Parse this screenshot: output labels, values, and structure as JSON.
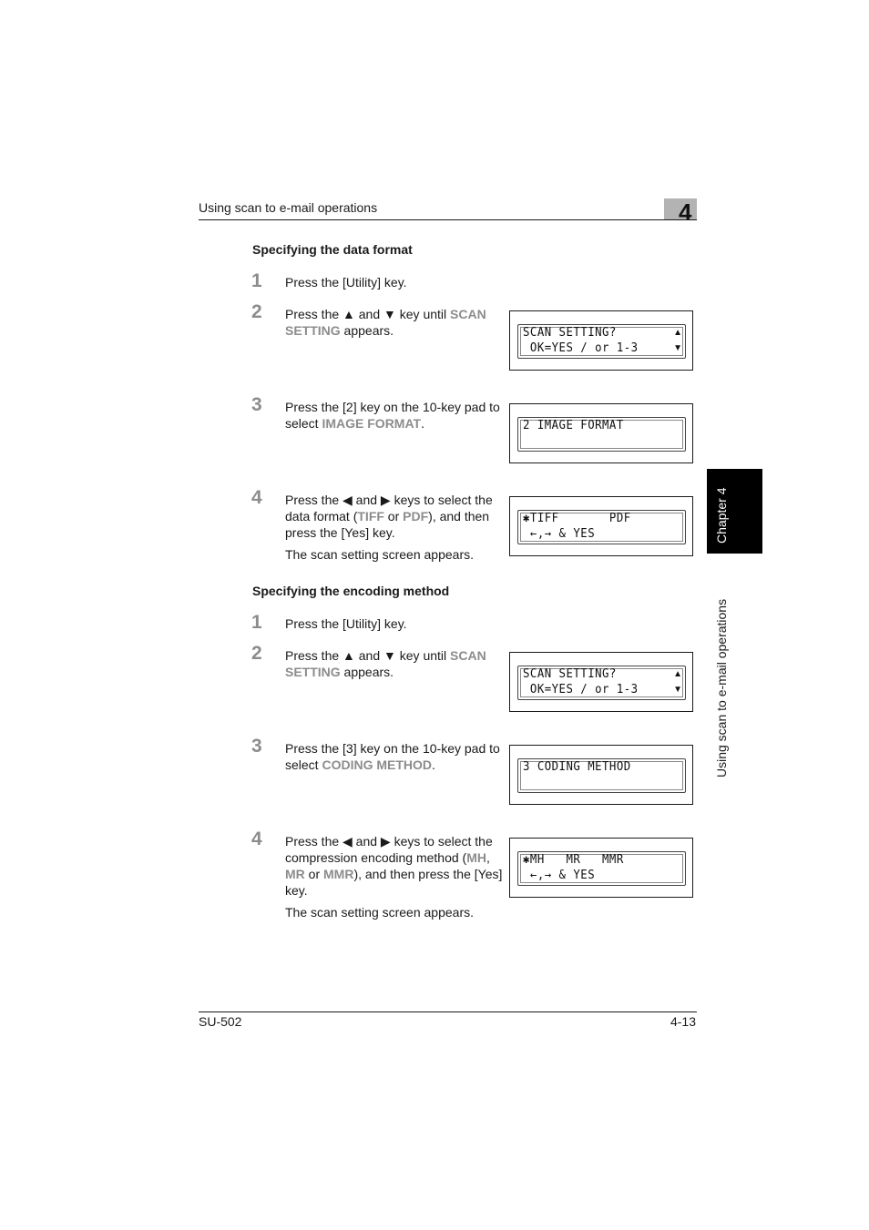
{
  "header": {
    "title": "Using scan to e-mail operations",
    "chapter_number": "4"
  },
  "side_tab": {
    "chapter_label": "Chapter 4",
    "section_label": "Using scan to e-mail operations"
  },
  "sections": [
    {
      "heading": "Specifying the data format",
      "steps": [
        {
          "number": "1",
          "parts": [
            "Press the [Utility] key."
          ]
        },
        {
          "number": "2",
          "parts": [
            "Press the ▲ and ▼ key until ",
            "SCAN SETTING",
            " appears."
          ]
        },
        {
          "number": "3",
          "parts": [
            "Press the [2] key on the 10-key pad to select ",
            "IMAGE FORMAT",
            "."
          ]
        },
        {
          "number": "4",
          "parts": [
            "Press the ◀ and ▶ keys to select the data format (",
            "TIFF",
            " or ",
            "PDF",
            "), and then press the [Yes] key."
          ],
          "note": "The scan setting screen appears."
        }
      ],
      "lcd_screens": [
        {
          "line1": "SCAN SETTING?",
          "line2": " OK=YES / or 1-3",
          "arrows": true
        },
        {
          "line1": "2 IMAGE FORMAT",
          "line2": "",
          "arrows": false
        },
        {
          "line1": "✱TIFF       PDF",
          "line2": " ←,→ & YES",
          "arrows": false
        }
      ]
    },
    {
      "heading": "Specifying the encoding method",
      "steps": [
        {
          "number": "1",
          "parts": [
            "Press the [Utility] key."
          ]
        },
        {
          "number": "2",
          "parts": [
            "Press the ▲ and ▼ key until ",
            "SCAN SETTING",
            " appears."
          ]
        },
        {
          "number": "3",
          "parts": [
            "Press the [3] key on the 10-key pad to select ",
            "CODING METHOD",
            "."
          ]
        },
        {
          "number": "4",
          "parts": [
            "Press the ◀ and ▶ keys to select the compression encoding method (",
            "MH",
            ", ",
            "MR",
            " or ",
            "MMR",
            "), and then press the [Yes] key."
          ],
          "note": "The scan setting screen appears."
        }
      ],
      "lcd_screens": [
        {
          "line1": "SCAN SETTING?",
          "line2": " OK=YES / or 1-3",
          "arrows": true
        },
        {
          "line1": "3 CODING METHOD",
          "line2": "",
          "arrows": false
        },
        {
          "line1": "✱MH   MR   MMR",
          "line2": " ←,→ & YES",
          "arrows": false
        }
      ]
    }
  ],
  "lcd_arrow_up": "▲",
  "lcd_arrow_down": "▼",
  "footer": {
    "model": "SU-502",
    "page": "4-13"
  },
  "colors": {
    "highlight": "#8c8c8c",
    "chapter_tab": "#b3b3b3"
  }
}
